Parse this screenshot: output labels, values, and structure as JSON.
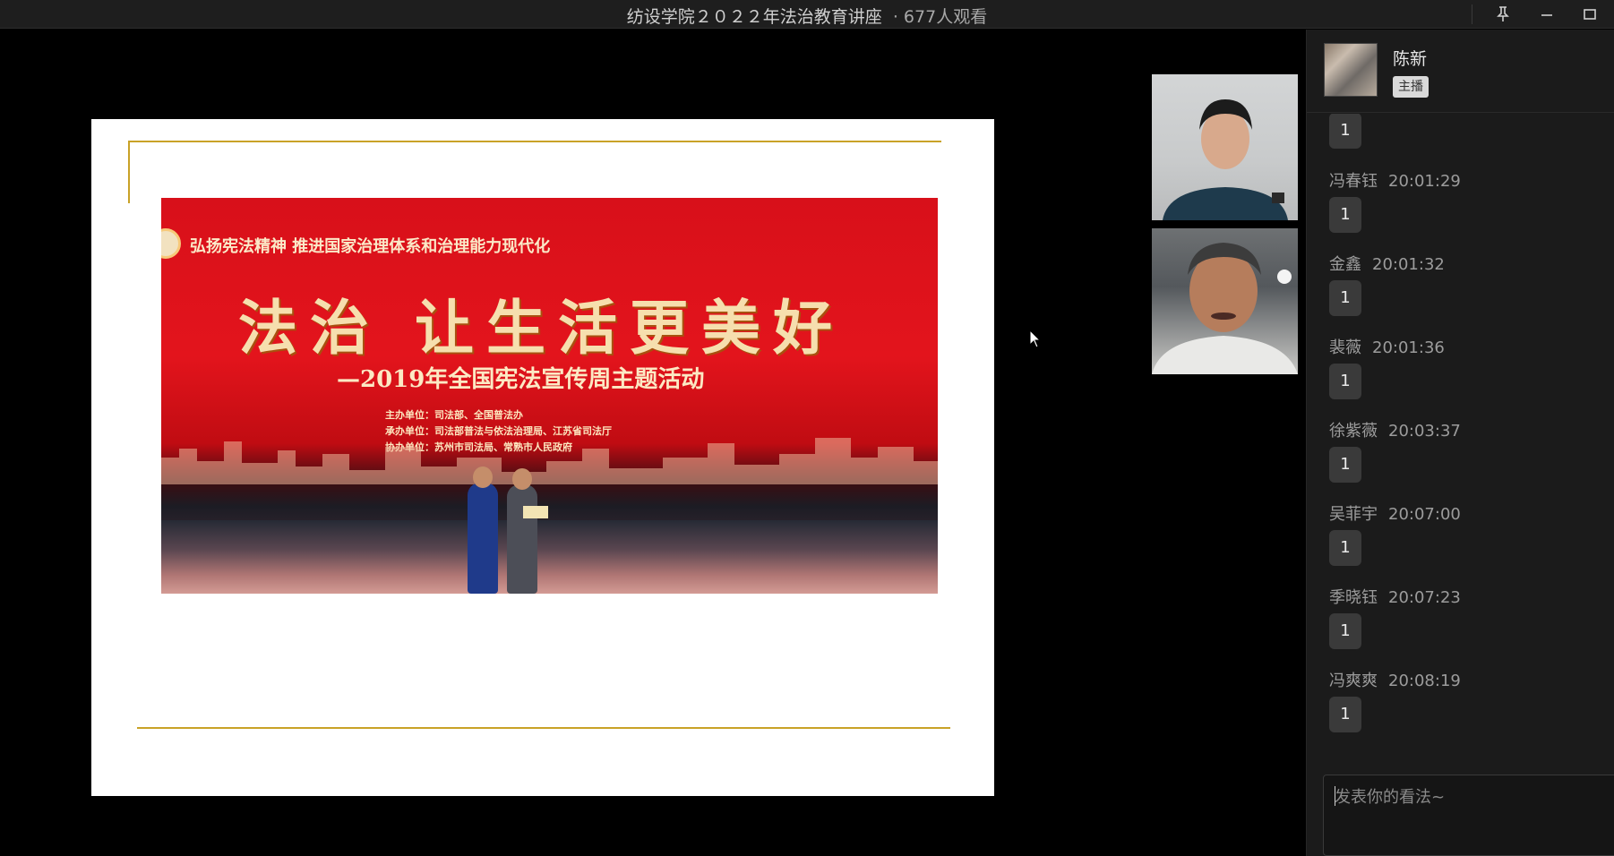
{
  "window": {
    "title": "纺设学院２０２２年法治教育讲座",
    "viewers": "· 677人观看"
  },
  "slide": {
    "banner_top_line": "弘扬宪法精神 推进国家治理体系和治理能力现代化",
    "banner_headline": "法治 让生活更美好",
    "banner_subheadline": "—2019年全国宪法宣传周主题活动",
    "banner_org_host": "主办单位：司法部、全国普法办",
    "banner_org_undertake": "承办单位：司法部普法与依法治理局、江苏省司法厅",
    "banner_org_assist": "协办单位：苏州市司法局、常熟市人民政府"
  },
  "host": {
    "name": "陈新",
    "badge": "主播"
  },
  "messages": [
    {
      "user": "",
      "time": "",
      "text": "1"
    },
    {
      "user": "冯春钰",
      "time": "20:01:29",
      "text": "1"
    },
    {
      "user": "金鑫",
      "time": "20:01:32",
      "text": "1"
    },
    {
      "user": "裴薇",
      "time": "20:01:36",
      "text": "1"
    },
    {
      "user": "徐紫薇",
      "time": "20:03:37",
      "text": "1"
    },
    {
      "user": "吴菲宇",
      "time": "20:07:00",
      "text": "1"
    },
    {
      "user": "季晓钰",
      "time": "20:07:23",
      "text": "1"
    },
    {
      "user": "冯爽爽",
      "time": "20:08:19",
      "text": "1"
    }
  ],
  "comment": {
    "placeholder": "发表你的看法~"
  },
  "icons": {
    "pin": "pin-icon",
    "minimize": "minimize-icon",
    "maximize": "maximize-icon",
    "cursor": "mouse-cursor-icon"
  },
  "colors": {
    "accent_gold": "#c9a227",
    "panel_bg": "#1b1b1b",
    "banner_red": "#e3141c"
  }
}
